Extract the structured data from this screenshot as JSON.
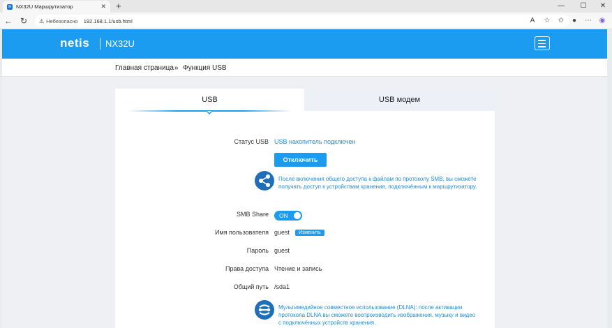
{
  "browser": {
    "tab_title": "NX32U Маршрутизатор",
    "tab_icon_letter": "n",
    "url": "192.168.1.1/usb.html",
    "insecure_label": "Небезопасно"
  },
  "header": {
    "logo": "netis",
    "model": "NX32U"
  },
  "breadcrumb": {
    "home": "Главная страница",
    "separator": "»",
    "current": "Функция USB"
  },
  "tabs": {
    "usb": "USB",
    "usb_modem": "USB модем"
  },
  "usb_status": {
    "label": "Статус USB",
    "value": "USB накопитель подключен"
  },
  "disconnect_button": "Отключить",
  "smb_info": "После включения общего доступа к файлам по протоколу SMB, вы сможете получать доступ к устройствам хранения, подключённым к маршрутизатору.",
  "smb_share": {
    "label": "SMB Share",
    "state": "ON"
  },
  "username": {
    "label": "Имя пользователя",
    "value": "guest",
    "edit_label": "Изменить"
  },
  "password": {
    "label": "Пароль",
    "value": "guest"
  },
  "access": {
    "label": "Права доступа",
    "value": "Чтение и запись"
  },
  "share_path": {
    "label": "Общий путь",
    "value": "/sda1"
  },
  "dlna_info": "Мультимедийное совместное использование (DLNA): после активации протокола DLNA вы сможете воспроизводить изображения, музыку и видео с подключённых устройств хранения.",
  "colors": {
    "accent": "#1c9cf0",
    "link": "#1c8ee0",
    "icon_circle": "#1f6fb8"
  }
}
